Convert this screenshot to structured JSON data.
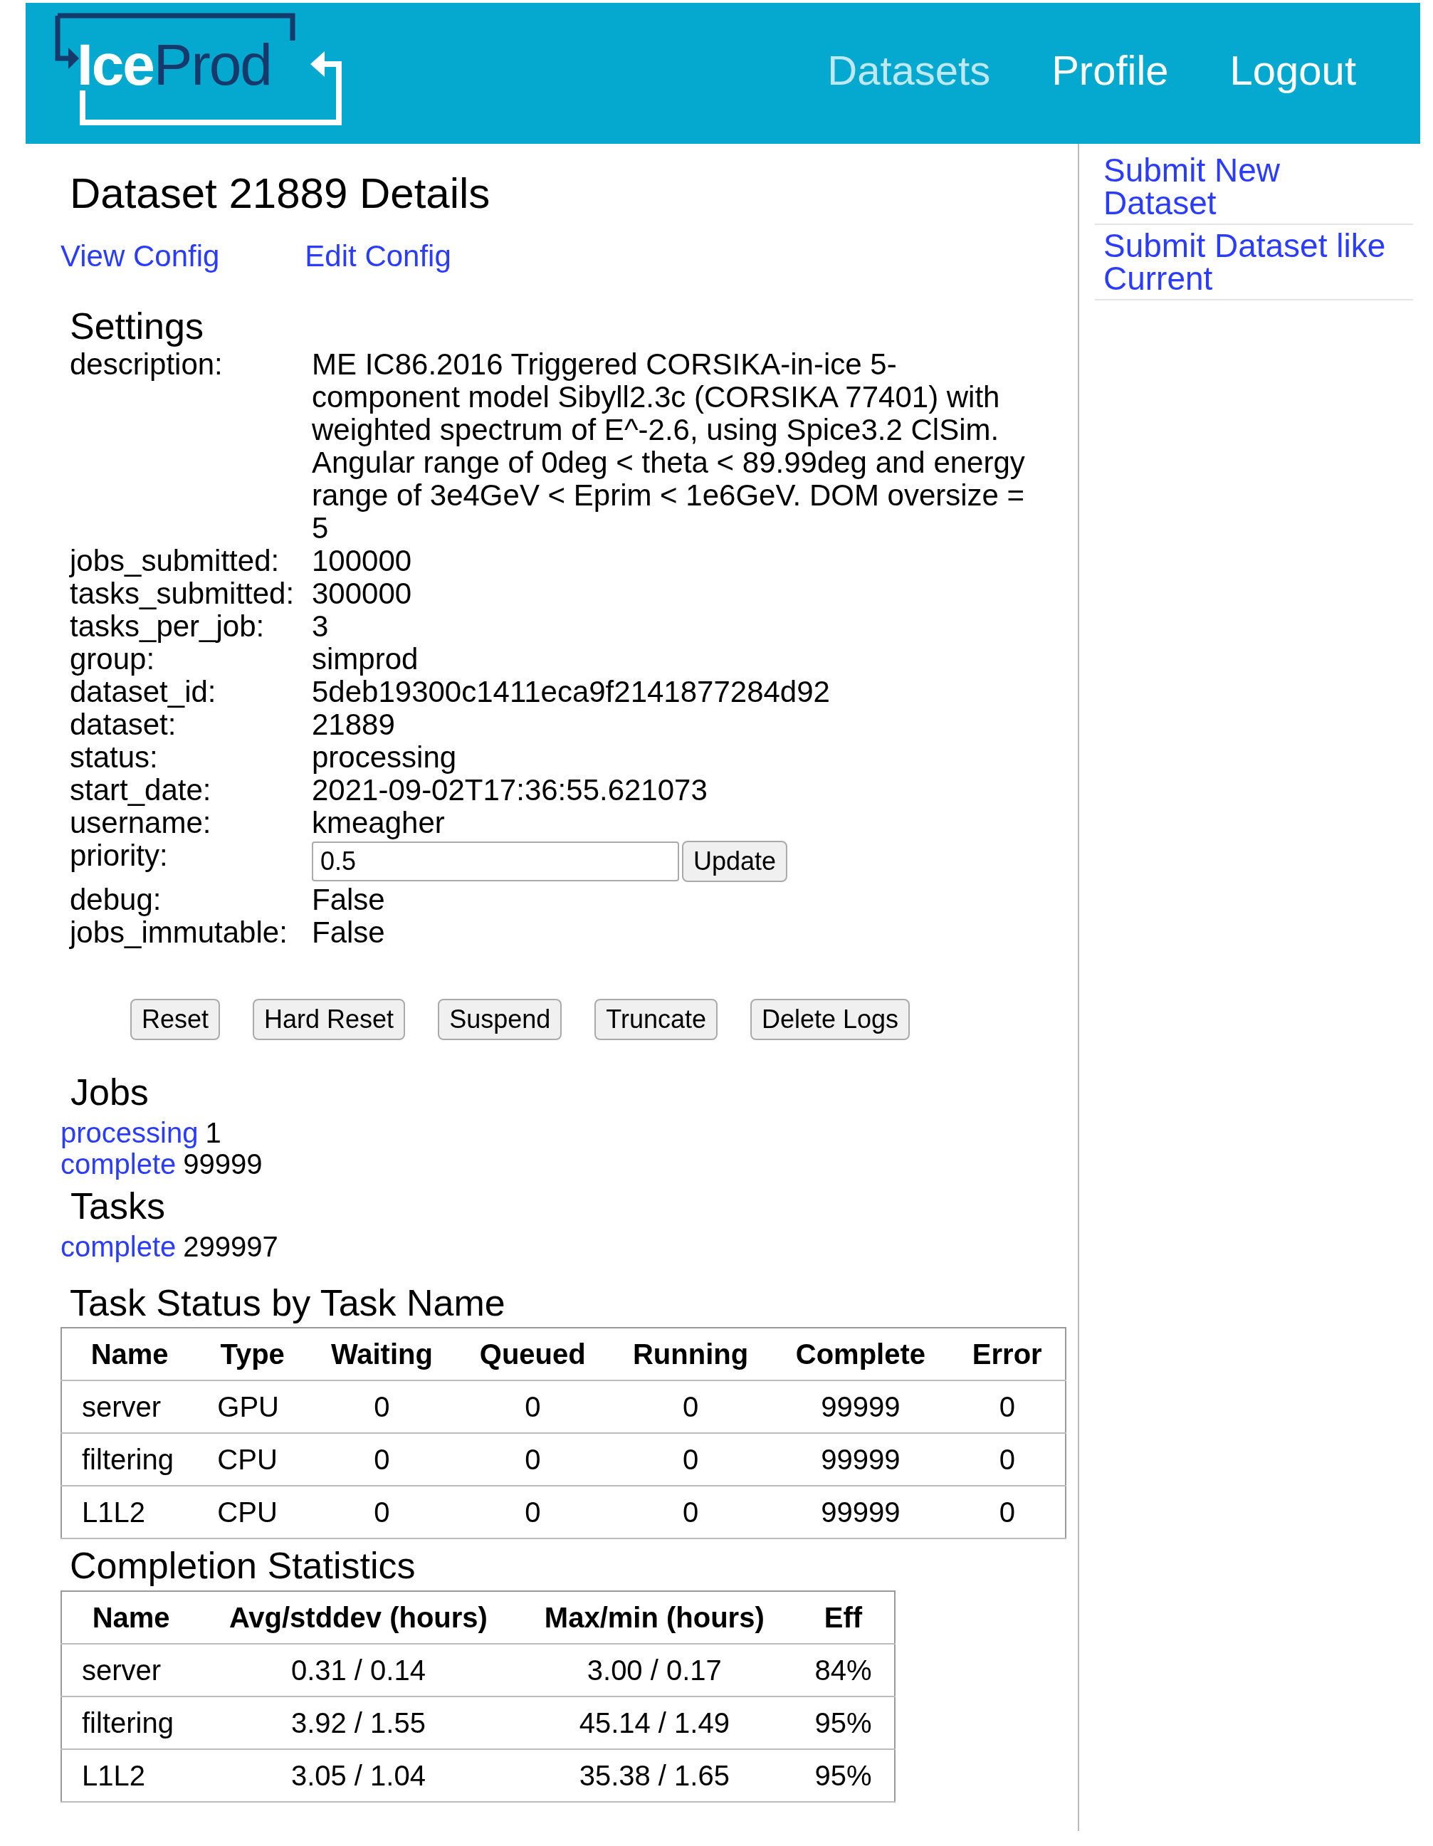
{
  "header": {
    "logo": {
      "part_1": "Ice",
      "part_2": "Prod"
    },
    "nav": [
      {
        "label": "Datasets",
        "selected": true
      },
      {
        "label": "Profile",
        "selected": false
      },
      {
        "label": "Logout",
        "selected": false
      }
    ]
  },
  "title": "Dataset 21889 Details",
  "config_links": [
    "View Config",
    "Edit Config"
  ],
  "settings": {
    "heading": "Settings",
    "rows": [
      {
        "kind": "text",
        "label": "description:",
        "value": "ME IC86.2016 Triggered CORSIKA-in-ice 5-component model Sibyll2.3c (CORSIKA 77401) with weighted spectrum of E^-2.6, using Spice3.2 ClSim. Angular range of 0deg < theta < 89.99deg and energy range of 3e4GeV < Eprim < 1e6GeV. DOM oversize = 5"
      },
      {
        "kind": "text",
        "label": "jobs_submitted:",
        "value": "100000"
      },
      {
        "kind": "text",
        "label": "tasks_submitted:",
        "value": "300000"
      },
      {
        "kind": "text",
        "label": "tasks_per_job:",
        "value": "3"
      },
      {
        "kind": "text",
        "label": "group:",
        "value": "simprod"
      },
      {
        "kind": "text",
        "label": "dataset_id:",
        "value": "5deb19300c1411eca9f2141877284d92"
      },
      {
        "kind": "text",
        "label": "dataset:",
        "value": "21889"
      },
      {
        "kind": "text",
        "label": "status:",
        "value": "processing"
      },
      {
        "kind": "text",
        "label": "start_date:",
        "value": "2021-09-02T17:36:55.621073"
      },
      {
        "kind": "text",
        "label": "username:",
        "value": "kmeagher"
      },
      {
        "kind": "input",
        "label": "priority:",
        "value": "0.5",
        "button": "Update"
      },
      {
        "kind": "text",
        "label": "debug:",
        "value": "False"
      },
      {
        "kind": "text",
        "label": "jobs_immutable:",
        "value": "False"
      }
    ]
  },
  "actions": [
    "Reset",
    "Hard Reset",
    "Suspend",
    "Truncate",
    "Delete Logs"
  ],
  "jobs": {
    "heading": "Jobs",
    "items": [
      {
        "status": "processing",
        "count": "1"
      },
      {
        "status": "complete",
        "count": "99999"
      }
    ]
  },
  "tasks": {
    "heading": "Tasks",
    "items": [
      {
        "status": "complete",
        "count": "299997"
      }
    ]
  },
  "task_status": {
    "heading": "Task Status by Task Name",
    "columns": [
      "Name",
      "Type",
      "Waiting",
      "Queued",
      "Running",
      "Complete",
      "Error"
    ],
    "rows": [
      [
        "server",
        "GPU",
        "0",
        "0",
        "0",
        "99999",
        "0"
      ],
      [
        "filtering",
        "CPU",
        "0",
        "0",
        "0",
        "99999",
        "0"
      ],
      [
        "L1L2",
        "CPU",
        "0",
        "0",
        "0",
        "99999",
        "0"
      ]
    ]
  },
  "completion": {
    "heading": "Completion Statistics",
    "columns": [
      "Name",
      "Avg/stddev (hours)",
      "Max/min (hours)",
      "Eff"
    ],
    "rows": [
      [
        "server",
        "0.31 / 0.14",
        "3.00 / 0.17",
        "84%"
      ],
      [
        "filtering",
        "3.92 / 1.55",
        "45.14 / 1.49",
        "95%"
      ],
      [
        "L1L2",
        "3.05 / 1.04",
        "35.38 / 1.65",
        "95%"
      ]
    ]
  },
  "sidebar": {
    "links": [
      "Submit New Dataset",
      "Submit Dataset like Current"
    ]
  }
}
